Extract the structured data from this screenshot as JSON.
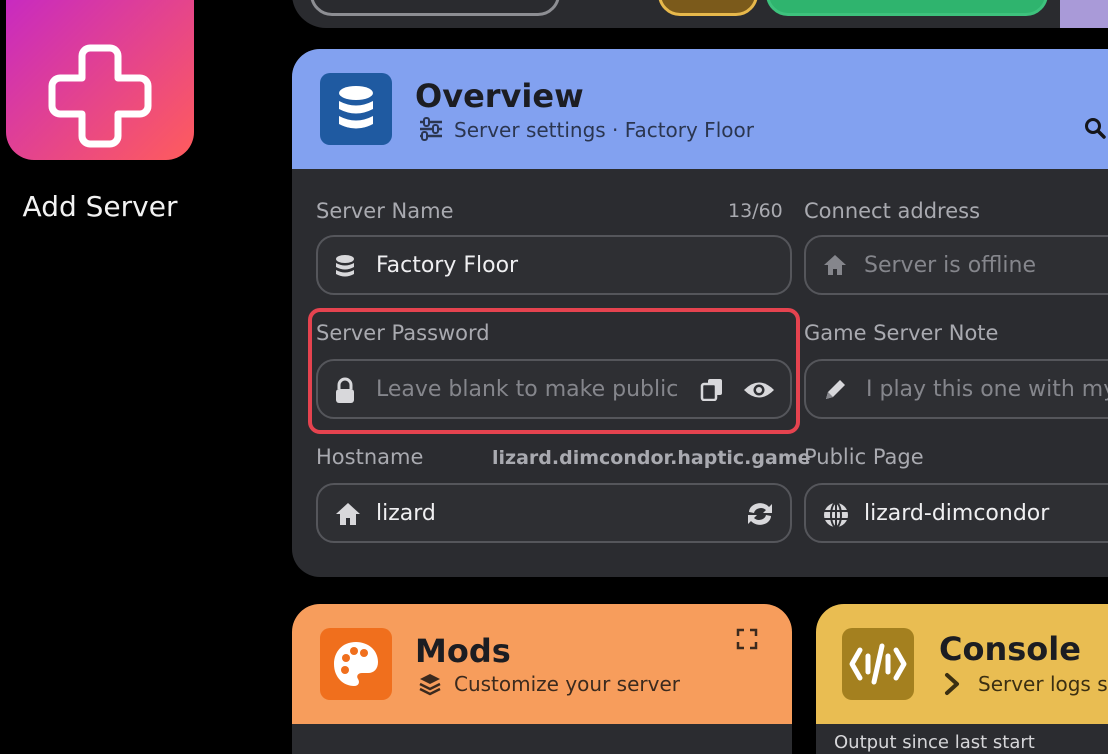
{
  "sidebar": {
    "add_server_label": "Add Server"
  },
  "overview": {
    "title": "Overview",
    "subtitle": "Server settings · Factory Floor",
    "fields": {
      "server_name": {
        "label": "Server Name",
        "counter": "13/60",
        "value": "Factory Floor"
      },
      "connect_address": {
        "label": "Connect address",
        "placeholder": "Server is offline"
      },
      "server_password": {
        "label": "Server Password",
        "placeholder": "Leave blank to make public"
      },
      "game_server_note": {
        "label": "Game Server Note",
        "placeholder": "I play this one with my"
      },
      "hostname": {
        "label": "Hostname",
        "full_host": "lizard.dimcondor.haptic.game",
        "value": "lizard"
      },
      "public_page": {
        "label": "Public Page",
        "value": "lizard-dimcondor"
      }
    }
  },
  "mods": {
    "title": "Mods",
    "subtitle": "Customize your server"
  },
  "console": {
    "title": "Console",
    "subtitle": "Server logs si",
    "output_label": "Output since last start"
  },
  "colors": {
    "overview_header": "#82a1f0",
    "mods_header": "#f79d5c",
    "console_header": "#e9bd52",
    "highlight": "#e5434f"
  }
}
